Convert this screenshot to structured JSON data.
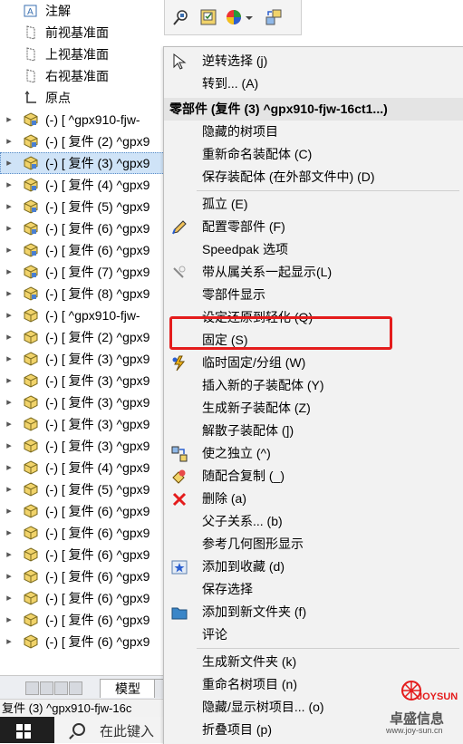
{
  "tree": {
    "top_items": [
      {
        "icon": "annotation-icon",
        "label": "注解"
      },
      {
        "icon": "plane-icon",
        "label": "前视基准面"
      },
      {
        "icon": "plane-icon",
        "label": "上视基准面"
      },
      {
        "icon": "plane-icon",
        "label": "右视基准面"
      },
      {
        "icon": "origin-icon",
        "label": "原点"
      }
    ],
    "components": [
      {
        "label": "(-) [ ^gpx910-fjw-",
        "icon": "part-icon"
      },
      {
        "label": "(-) [ 复件 (2) ^gpx9",
        "icon": "part-icon"
      },
      {
        "label": "(-) [ 复件 (3) ^gpx9",
        "icon": "part-icon",
        "selected": true
      },
      {
        "label": "(-) [ 复件 (4) ^gpx9",
        "icon": "part-icon"
      },
      {
        "label": "(-) [ 复件 (5) ^gpx9",
        "icon": "part-icon"
      },
      {
        "label": "(-) [ 复件 (6) ^gpx9",
        "icon": "part-icon"
      },
      {
        "label": "(-) [ 复件 (6) ^gpx9",
        "icon": "part-icon"
      },
      {
        "label": "(-) [ 复件 (7) ^gpx9",
        "icon": "part-icon"
      },
      {
        "label": "(-) [ 复件 (8) ^gpx9",
        "icon": "part-icon"
      },
      {
        "label": "(-) [ ^gpx910-fjw-",
        "icon": "part-yellow-icon"
      },
      {
        "label": "(-) [ 复件 (2) ^gpx9",
        "icon": "part-yellow-icon"
      },
      {
        "label": "(-) [ 复件 (3) ^gpx9",
        "icon": "part-yellow-icon"
      },
      {
        "label": "(-) [ 复件 (3) ^gpx9",
        "icon": "part-yellow-icon"
      },
      {
        "label": "(-) [ 复件 (3) ^gpx9",
        "icon": "part-yellow-icon"
      },
      {
        "label": "(-) [ 复件 (3) ^gpx9",
        "icon": "part-yellow-icon"
      },
      {
        "label": "(-) [ 复件 (3) ^gpx9",
        "icon": "part-yellow-icon"
      },
      {
        "label": "(-) [ 复件 (4) ^gpx9",
        "icon": "part-yellow-icon"
      },
      {
        "label": "(-) [ 复件 (5) ^gpx9",
        "icon": "part-yellow-icon"
      },
      {
        "label": "(-) [ 复件 (6) ^gpx9",
        "icon": "part-yellow-icon"
      },
      {
        "label": "(-) [ 复件 (6) ^gpx9",
        "icon": "part-yellow-icon"
      },
      {
        "label": "(-) [ 复件 (6) ^gpx9",
        "icon": "part-yellow-icon"
      },
      {
        "label": "(-) [ 复件 (6) ^gpx9",
        "icon": "part-yellow-icon"
      },
      {
        "label": "(-) [ 复件 (6) ^gpx9",
        "icon": "part-yellow-icon"
      },
      {
        "label": "(-) [ 复件 (6) ^gpx9",
        "icon": "part-yellow-icon"
      },
      {
        "label": "(-) [ 复件 (6) ^gpx9",
        "icon": "part-yellow-icon"
      }
    ]
  },
  "tabs": {
    "model_label": "模型"
  },
  "status": {
    "text": "复件 (3) ^gpx910-fjw-16c"
  },
  "taskbar": {
    "search_placeholder": "在此键入"
  },
  "menu": {
    "header": "零部件 (复件 (3) ^gpx910-fjw-16ct1...)",
    "top_items": [
      {
        "icon": "select-arrow-icon",
        "label": "逆转选择 (j)"
      },
      {
        "icon": "",
        "label": "转到... (A)"
      }
    ],
    "items": [
      {
        "icon": "",
        "label": "隐藏的树项目"
      },
      {
        "icon": "",
        "label": "重新命名装配体 (C)"
      },
      {
        "icon": "",
        "label": "保存装配体 (在外部文件中) (D)"
      },
      {
        "icon": "",
        "label": "孤立 (E)"
      },
      {
        "icon": "configure-pencil-icon",
        "label": "配置零部件 (F)"
      },
      {
        "icon": "",
        "label": "Speedpak 选项"
      },
      {
        "icon": "mates-icon",
        "label": "带从属关系一起显示(L)"
      },
      {
        "icon": "",
        "label": "零部件显示"
      },
      {
        "icon": "",
        "label": "设定还原到轻化 (Q)"
      },
      {
        "icon": "",
        "label": "固定 (S)"
      },
      {
        "icon": "temp-fix-icon",
        "label": "临时固定/分组 (W)"
      },
      {
        "icon": "",
        "label": "插入新的子装配体 (Y)"
      },
      {
        "icon": "",
        "label": "生成新子装配体 (Z)"
      },
      {
        "icon": "",
        "label": "解散子装配体 (])"
      },
      {
        "icon": "make-independent-icon",
        "label": "使之独立 (^)"
      },
      {
        "icon": "copy-with-mates-icon",
        "label": "随配合复制 (_)"
      },
      {
        "icon": "delete-x-icon",
        "label": "删除 (a)"
      },
      {
        "icon": "",
        "label": "父子关系... (b)"
      },
      {
        "icon": "",
        "label": "参考几何图形显示"
      },
      {
        "icon": "favorite-star-icon",
        "label": "添加到收藏 (d)"
      },
      {
        "icon": "",
        "label": "保存选择"
      },
      {
        "icon": "folder-icon",
        "label": "添加到新文件夹 (f)"
      },
      {
        "icon": "",
        "label": "评论"
      },
      {
        "icon": "",
        "label": "生成新文件夹 (k)"
      },
      {
        "icon": "",
        "label": "重命名树项目 (n)"
      },
      {
        "icon": "",
        "label": "隐藏/显示树项目... (o)"
      },
      {
        "icon": "",
        "label": "折叠项目 (p)"
      }
    ]
  },
  "watermark": {
    "logo_text": "JOYSUN",
    "name": "卓盛信息",
    "url": "www.joy-sun.cn"
  },
  "colors": {
    "highlight_box": "#e41c1c",
    "selection": "#cfe3f7",
    "menu_bg": "#f2f2f2"
  }
}
